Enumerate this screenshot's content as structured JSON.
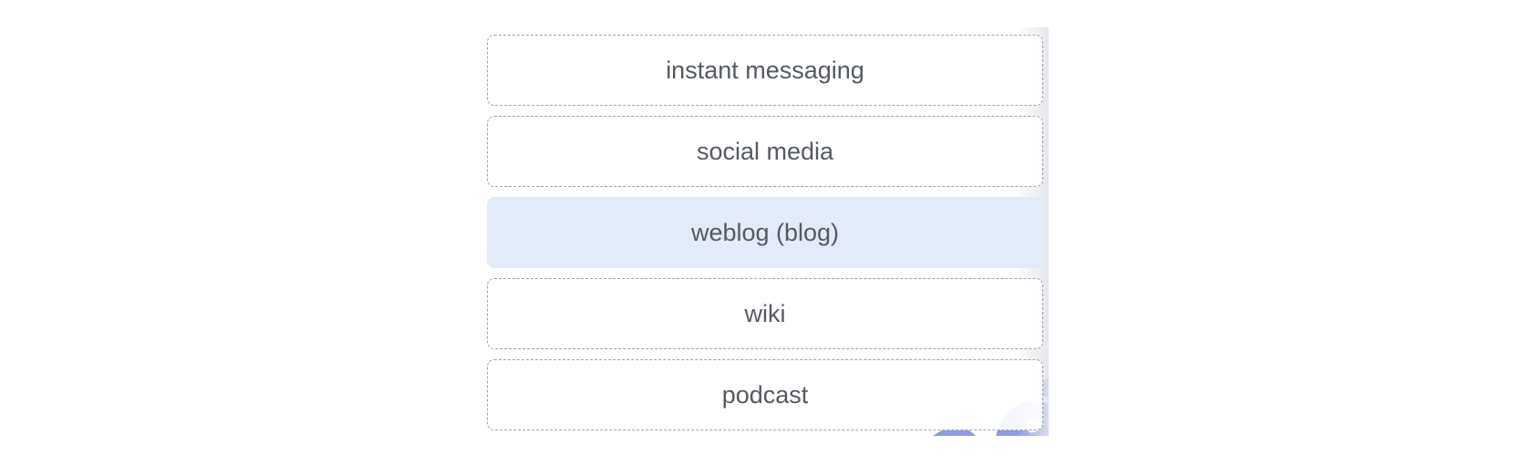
{
  "options": [
    {
      "label": "instant messaging",
      "selected": false
    },
    {
      "label": "social media",
      "selected": false
    },
    {
      "label": "weblog (blog)",
      "selected": true
    },
    {
      "label": "wiki",
      "selected": false
    },
    {
      "label": "podcast",
      "selected": false
    }
  ],
  "colors": {
    "selected_background": "#e2ebf7",
    "option_border": "#9aa3b3",
    "text": "#555a60",
    "watermark": "#8f99e6"
  }
}
